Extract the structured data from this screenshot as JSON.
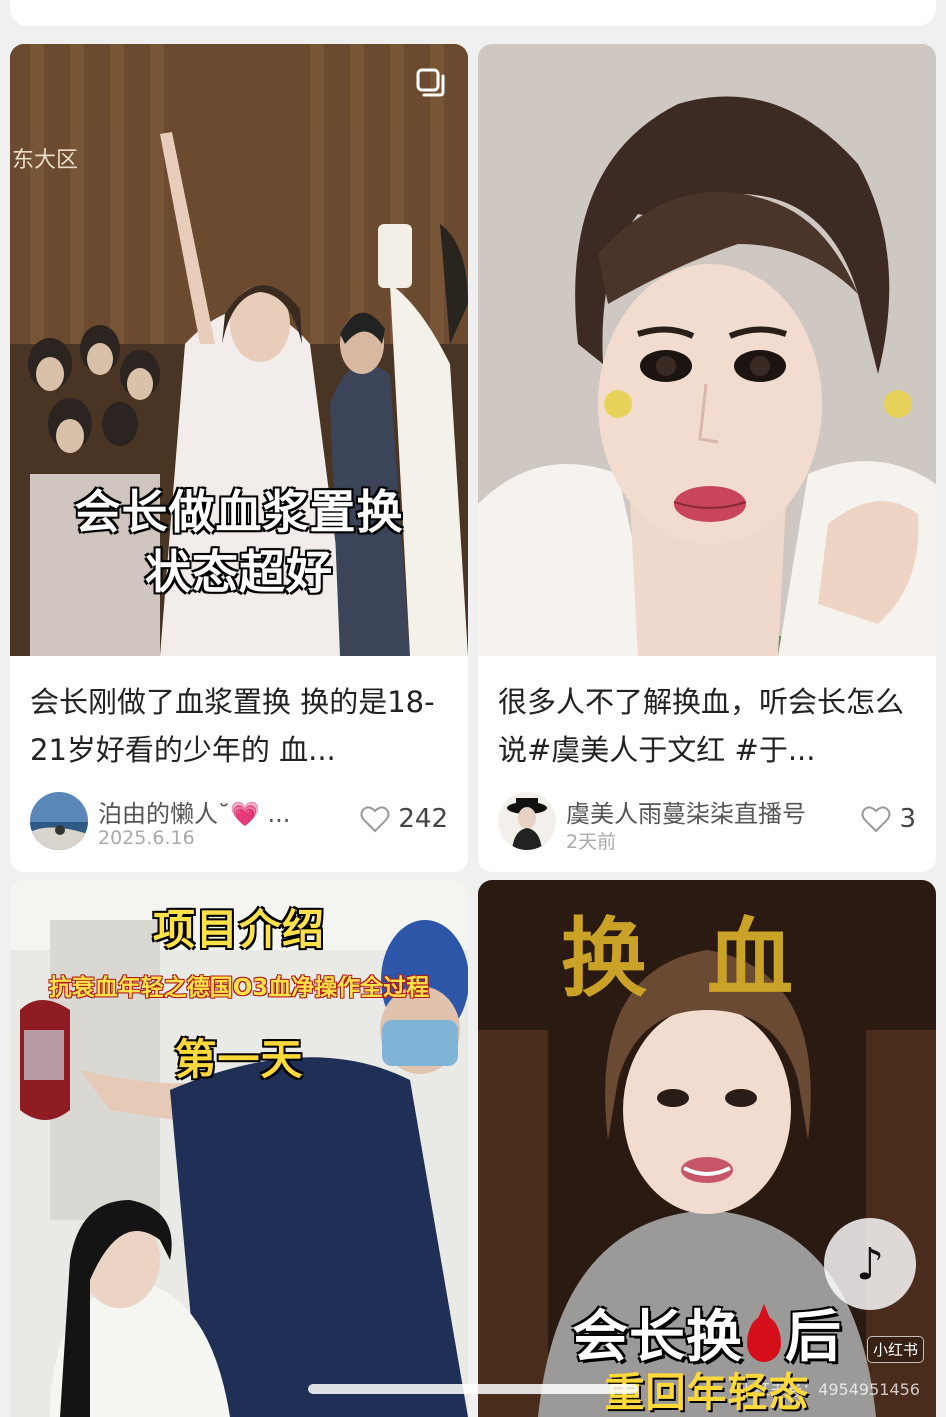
{
  "cards": [
    {
      "overlay": {
        "line1": "会长做血浆置换",
        "line2": "状态超好",
        "corner": "东大区"
      },
      "icon": "multi-image-icon",
      "title": "会长刚做了血浆置换 换的是18-21岁好看的少年的 血...",
      "author": "泊由的懒人˘💗 ...",
      "date": "2025.6.16",
      "likes": "242"
    },
    {
      "title": "很多人不了解换血，听会长怎么说#虞美人于文红 #于...",
      "author": "虞美人雨蔓柒柒直播号",
      "date": "2天前",
      "likes": "3"
    },
    {
      "overlay": {
        "title": "项目介绍",
        "subtitle": "抗衰血年轻之德国O3血净操作全过程",
        "day": "第一天"
      }
    },
    {
      "overlay": {
        "big": "换血",
        "bottom_left": "会长换",
        "bottom_right": "后",
        "bottom_line2": "重回年轻态"
      },
      "badges": {
        "app_badge": "小红书",
        "watermark": "小红书号：4954951456",
        "tiktok": "♪"
      }
    }
  ],
  "colors": {
    "accent_yellow": "#ffe24a",
    "blood_red": "#d40f1a",
    "gold": "#c9a227"
  }
}
